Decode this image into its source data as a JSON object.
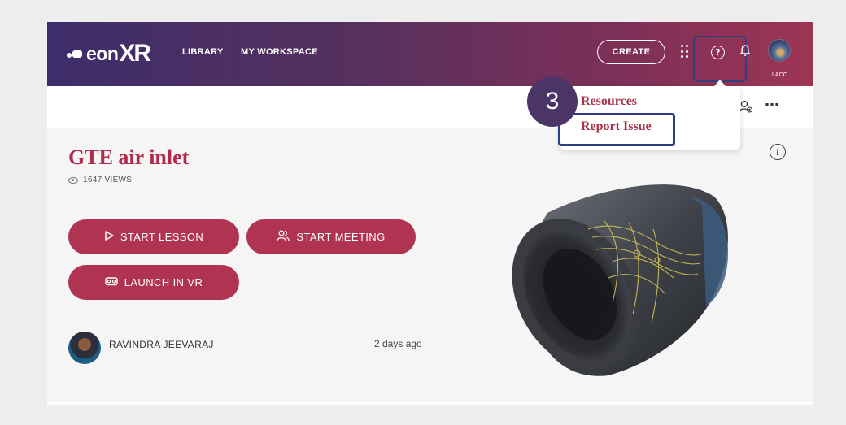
{
  "header": {
    "logo_text": "eon",
    "logo_text_xr": "XR",
    "nav": [
      "LIBRARY",
      "MY WORKSPACE"
    ],
    "create_label": "CREATE",
    "help_icon": "question-circle-icon",
    "help_glyph": "?",
    "avatar_label": "LACC"
  },
  "dropdown": {
    "items": [
      "Resources",
      "Report Issue"
    ]
  },
  "annotation": {
    "step_number": "3"
  },
  "lesson": {
    "title": "GTE air inlet",
    "views": "1647 VIEWS",
    "buttons": {
      "start_lesson": "START LESSON",
      "start_meeting": "START MEETING",
      "launch_vr": "LAUNCH IN VR"
    },
    "author": "RAVINDRA JEEVARAJ",
    "timestamp": "2 days ago"
  },
  "colors": {
    "brand": "#b03352",
    "header_start": "#3d2d6a",
    "header_end": "#9e3554",
    "highlight": "#2d3e7e"
  }
}
